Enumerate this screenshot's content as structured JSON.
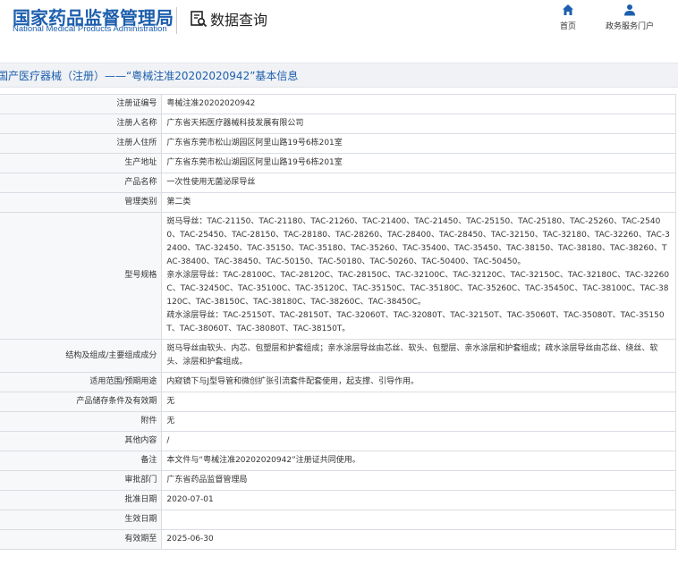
{
  "header": {
    "logo_cn": "国家药品监督管理局",
    "logo_en": "National Medical Products Administration",
    "search_title": "数据查询",
    "nav": [
      {
        "label": "首页",
        "icon": "home-icon"
      },
      {
        "label": "政务服务门户",
        "icon": "user-icon"
      }
    ]
  },
  "page": {
    "title": "国产医疗器械（注册）——“粤械注准20202020942”基本信息"
  },
  "colors": {
    "brand": "#1d5fae",
    "label_bg": "#f7f8fa",
    "border": "#d9dde3",
    "title_bar_bg": "#f0f2f5"
  },
  "rows": [
    {
      "label": "注册证编号",
      "value": "粤械注准20202020942"
    },
    {
      "label": "注册人名称",
      "value": "广东省天拓医疗器械科技发展有限公司"
    },
    {
      "label": "注册人住所",
      "value": "广东省东莞市松山湖园区阿里山路19号6栋201室"
    },
    {
      "label": "生产地址",
      "value": "广东省东莞市松山湖园区阿里山路19号6栋201室"
    },
    {
      "label": "产品名称",
      "value": "一次性使用无菌泌尿导丝"
    },
    {
      "label": "管理类别",
      "value": "第二类"
    },
    {
      "label": "型号规格",
      "value": "斑马导丝：TAC-21150、TAC-21180、TAC-21260、TAC-21400、TAC-21450、TAC-25150、TAC-25180、TAC-25260、TAC-25400、TAC-25450、TAC-28150、TAC-28180、TAC-28260、TAC-28400、TAC-28450、TAC-32150、TAC-32180、TAC-32260、TAC-32400、TAC-32450、TAC-35150、TAC-35180、TAC-35260、TAC-35400、TAC-35450、TAC-38150、TAC-38180、TAC-38260、TAC-38400、TAC-38450、TAC-50150、TAC-50180、TAC-50260、TAC-50400、TAC-50450。\n亲水涂层导丝：TAC-28100C、TAC-28120C、TAC-28150C、TAC-32100C、TAC-32120C、TAC-32150C、TAC-32180C、TAC-32260C、TAC-32450C、TAC-35100C、TAC-35120C、TAC-35150C、TAC-35180C、TAC-35260C、TAC-35450C、TAC-38100C、TAC-38120C、TAC-38150C、TAC-38180C、TAC-38260C、TAC-38450C。\n疏水涂层导丝：TAC-25150T、TAC-28150T、TAC-32060T、TAC-32080T、TAC-32150T、TAC-35060T、TAC-35080T、TAC-35150T、TAC-38060T、TAC-38080T、TAC-38150T。"
    },
    {
      "label": "结构及组成/主要组成成分",
      "value": "斑马导丝由软头、内芯、包塑层和护套组成；亲水涂层导丝由芯丝、软头、包塑层、亲水涂层和护套组成；疏水涂层导丝由芯丝、绕丝、软头、涂层和护套组成。"
    },
    {
      "label": "适用范围/预期用途",
      "value": "内窥镜下与J型导管和微创扩张引流套件配套使用，起支撑、引导作用。"
    },
    {
      "label": "产品储存条件及有效期",
      "value": "无"
    },
    {
      "label": "附件",
      "value": "无"
    },
    {
      "label": "其他内容",
      "value": "/"
    },
    {
      "label": "备注",
      "value": "本文件与“粤械注准20202020942”注册证共同使用。"
    },
    {
      "label": "审批部门",
      "value": "广东省药品监督管理局"
    },
    {
      "label": "批准日期",
      "value": "2020-07-01"
    },
    {
      "label": "生效日期",
      "value": ""
    },
    {
      "label": "有效期至",
      "value": "2025-06-30"
    }
  ]
}
